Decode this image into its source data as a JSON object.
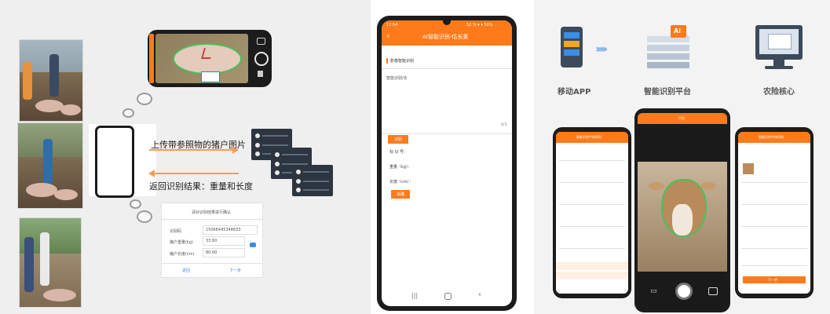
{
  "left": {
    "upload_label": "上传带参照物的猪户图片",
    "result_label": "返回识别结果：重量和长度",
    "card": {
      "title": "请对识别结果进行确认",
      "id_label": "识别码",
      "id_value": "15066445348633",
      "weight_label": "猪户重量(kg)",
      "weight_value": "33.60",
      "length_label": "猪户长度(cm)",
      "length_value": "80.00",
      "back_button": "返回",
      "next_button": "下一步"
    }
  },
  "mid": {
    "status_time": "17:54",
    "status_right": "52 % ▾ ▾ 50%",
    "header_title": "AI智能识别-估长重",
    "section_title": "影像智能识别",
    "field_label": "智能识别/长",
    "char_count": "0/1",
    "recognize_button": "识别",
    "id_label": "标 识 号：",
    "weight_label": "重量（kg）：",
    "length_label": "长度（cm）：",
    "submit_button": "采确"
  },
  "right": {
    "mobile_app_label": "移动APP",
    "ai_badge": "Ai",
    "platform_label": "智能识别平台",
    "core_label": "农险核心",
    "left_phone_header": "智能识别牛体资料",
    "center_phone_header": "识别",
    "right_phone_header": "智能识别牛体资料",
    "right_phone_button": "下一步"
  },
  "colors": {
    "accent": "#ff7a1a",
    "arrow_blue": "#3b8ee6",
    "server": "#2d3540"
  }
}
